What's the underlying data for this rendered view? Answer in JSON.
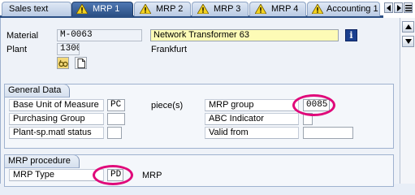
{
  "tabs": [
    {
      "label": "Sales text",
      "active": false
    },
    {
      "label": "MRP 1",
      "active": true
    },
    {
      "label": "MRP 2",
      "active": false
    },
    {
      "label": "MRP 3",
      "active": false
    },
    {
      "label": "MRP 4",
      "active": false
    },
    {
      "label": "Accounting 1",
      "active": false
    }
  ],
  "header": {
    "material_label": "Material",
    "material_value": "M-0063",
    "material_description": "Network Transformer 63",
    "plant_label": "Plant",
    "plant_value": "1300",
    "plant_name": "Frankfurt",
    "info_button": "i"
  },
  "general_data": {
    "title": "General Data",
    "base_uom_label": "Base Unit of Measure",
    "base_uom_value": "PC",
    "base_uom_text": "piece(s)",
    "purchasing_group_label": "Purchasing Group",
    "purchasing_group_value": "",
    "plant_sp_status_label": "Plant-sp.matl status",
    "plant_sp_status_value": "",
    "mrp_group_label": "MRP group",
    "mrp_group_value": "0085",
    "abc_indicator_label": "ABC Indicator",
    "abc_indicator_value": "",
    "valid_from_label": "Valid from",
    "valid_from_value": ""
  },
  "mrp_procedure": {
    "title": "MRP procedure",
    "mrp_type_label": "MRP Type",
    "mrp_type_value": "PD",
    "mrp_type_text": "MRP"
  },
  "highlight_color": "#e0097a",
  "accent_color": "#2b4f84"
}
